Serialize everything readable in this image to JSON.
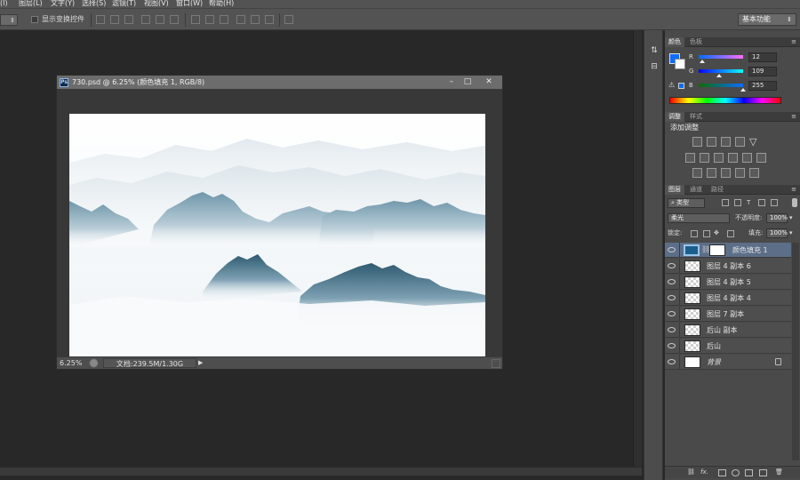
{
  "menu": [
    "(I)",
    "图层(L)",
    "文字(Y)",
    "选择(S)",
    "滤镜(T)",
    "视图(V)",
    "窗口(W)",
    "帮助(H)"
  ],
  "options_bar": {
    "show_transform_label": "显示变换控件",
    "workspace": "基本功能"
  },
  "document": {
    "title": "730.psd @ 6.25% (颜色填充 1, RGB/8)",
    "zoom": "6.25%",
    "doc_info": "文档:239.5M/1.30G",
    "ps_badge": "Ps",
    "window_buttons": [
      "–",
      "□",
      "✕"
    ]
  },
  "color_panel": {
    "tabs": [
      "颜色",
      "色板"
    ],
    "channels": [
      {
        "label": "R",
        "value": "12"
      },
      {
        "label": "G",
        "value": "109"
      },
      {
        "label": "B",
        "value": "255"
      }
    ],
    "foreground_color": "#0c6dff",
    "background_color": "#ffffff"
  },
  "adjustments_panel": {
    "tabs": [
      "调整",
      "样式"
    ],
    "title": "添加调整"
  },
  "layers_panel": {
    "tabs": [
      "图层",
      "通道",
      "路径"
    ],
    "filter_kind": "类型",
    "blend_mode": "柔光",
    "opacity_label": "不透明度:",
    "opacity_value": "100%",
    "lock_label": "锁定:",
    "fill_label": "填充:",
    "fill_value": "100%",
    "layers": [
      {
        "name": "颜色填充 1",
        "selected": true,
        "locked": false,
        "italic": false
      },
      {
        "name": "图层 4 副本 6",
        "selected": false,
        "locked": false,
        "italic": false
      },
      {
        "name": "图层 4 副本 5",
        "selected": false,
        "locked": false,
        "italic": false
      },
      {
        "name": "图层 4 副本 4",
        "selected": false,
        "locked": false,
        "italic": false
      },
      {
        "name": "图层 7 副本",
        "selected": false,
        "locked": false,
        "italic": false
      },
      {
        "name": "后山 副本",
        "selected": false,
        "locked": false,
        "italic": false
      },
      {
        "name": "后山",
        "selected": false,
        "locked": false,
        "italic": false
      },
      {
        "name": "背景",
        "selected": false,
        "locked": true,
        "italic": true
      }
    ],
    "footer_icons": [
      "link-icon",
      "fx-icon",
      "mask-icon",
      "adjustment-icon",
      "group-icon",
      "new-layer-icon",
      "trash-icon"
    ]
  }
}
